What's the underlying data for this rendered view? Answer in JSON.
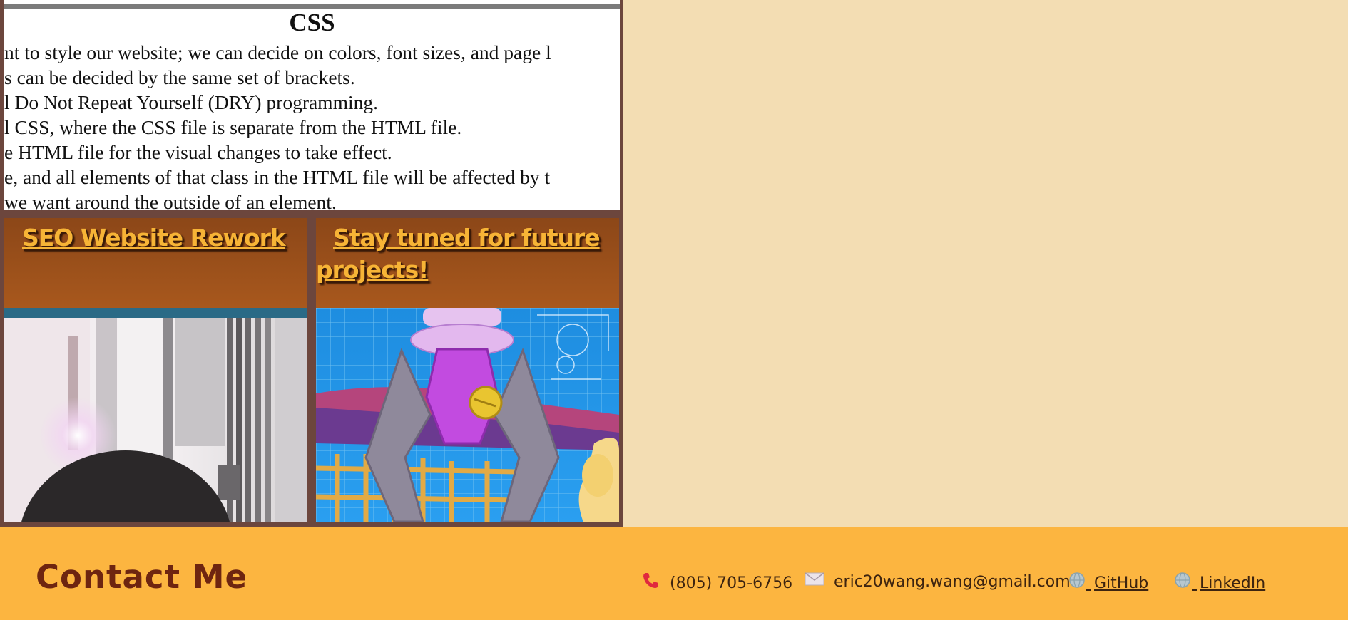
{
  "css_card": {
    "title": "CSS",
    "lines": [
      "nt to style our website; we can decide on colors, font sizes, and page l",
      "s can be decided by the same set of brackets.",
      "l Do Not Repeat Yourself (DRY) programming.",
      "l CSS, where the CSS file is separate from the HTML file.",
      "e HTML file for the visual changes to take effect.",
      "e, and all elements of that class in the HTML file will be affected by t",
      " we want around the outside of an element."
    ]
  },
  "projects": [
    {
      "title": "SEO Website Rework",
      "image": "person-at-window-photo"
    },
    {
      "title": "Stay tuned for future projects!",
      "image": "robot-claw-illustration"
    }
  ],
  "footer": {
    "heading": "Contact Me",
    "phone": {
      "icon": "phone-icon",
      "text": "(805) 705-6756"
    },
    "email": {
      "icon": "envelope-icon",
      "text": "eric20wang.wang@gmail.com"
    },
    "github": {
      "icon": "globe-icon",
      "text": "GitHub"
    },
    "linkedin": {
      "icon": "globe-icon",
      "text": "LinkedIn"
    }
  },
  "colors": {
    "page_background": "#f3ddb3",
    "frame": "#6c463d",
    "card_header": "#9a5019",
    "project_title": "#f7b436",
    "footer_background": "#fcb540",
    "footer_heading": "#6e2510"
  }
}
